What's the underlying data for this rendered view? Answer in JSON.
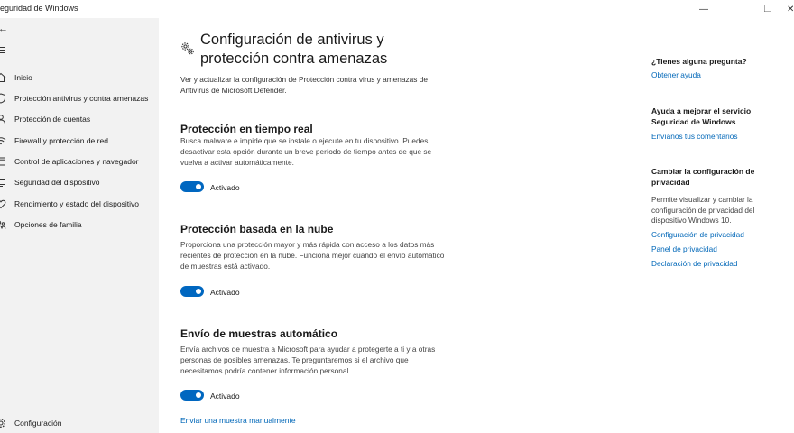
{
  "window": {
    "title": "Seguridad de Windows",
    "minimize_glyph": "—",
    "maximize_glyph": "❐",
    "close_glyph": "✕"
  },
  "sidebar": {
    "back_glyph": "←",
    "items": [
      {
        "label": "Inicio",
        "icon": "home-icon"
      },
      {
        "label": "Protección antivirus y contra amenazas",
        "icon": "shield-icon"
      },
      {
        "label": "Protección de cuentas",
        "icon": "person-icon"
      },
      {
        "label": "Firewall y protección de red",
        "icon": "wifi-icon"
      },
      {
        "label": "Control de aplicaciones y navegador",
        "icon": "browser-icon"
      },
      {
        "label": "Seguridad del dispositivo",
        "icon": "device-icon"
      },
      {
        "label": "Rendimiento y estado del dispositivo",
        "icon": "heart-icon"
      },
      {
        "label": "Opciones de familia",
        "icon": "family-icon"
      }
    ],
    "settings": {
      "label": "Configuración",
      "icon": "gear-icon"
    }
  },
  "main": {
    "title": "Configuración de antivirus y protección contra amenazas",
    "description": "Ver y actualizar la configuración de Protección contra virus y amenazas de Antivirus de Microsoft Defender.",
    "sections": [
      {
        "title": "Protección en tiempo real",
        "description": "Busca malware e impide que se instale o ejecute en tu dispositivo. Puedes desactivar esta opción durante un breve período de tiempo antes de que se vuelva a activar automáticamente.",
        "toggle_on": true,
        "toggle_label": "Activado"
      },
      {
        "title": "Protección basada en la nube",
        "description": "Proporciona una protección mayor y más rápida con acceso a los datos más recientes de protección en la nube. Funciona mejor cuando el envío automático de muestras está activado.",
        "toggle_on": true,
        "toggle_label": "Activado"
      },
      {
        "title": "Envío de muestras automático",
        "description": "Envía archivos de muestra a Microsoft para ayudar a protegerte a ti y a otras personas de posibles amenazas. Te preguntaremos si el archivo que necesitamos podría contener información personal.",
        "toggle_on": true,
        "toggle_label": "Activado"
      }
    ],
    "manual_link": "Enviar una muestra manualmente"
  },
  "side_panel": {
    "question_heading": "¿Tienes alguna pregunta?",
    "help_link": "Obtener ayuda",
    "improve_heading": "Ayuda a mejorar el servicio Seguridad de Windows",
    "feedback_link": "Envíanos tus comentarios",
    "privacy_heading": "Cambiar la configuración de privacidad",
    "privacy_text": "Permite visualizar y cambiar la configuración de privacidad del dispositivo Windows 10.",
    "privacy_links": [
      "Configuración de privacidad",
      "Panel de privacidad",
      "Declaración de privacidad"
    ]
  },
  "colors": {
    "accent": "#0067c0",
    "link": "#0067b8",
    "sidebar_bg": "#f2f2f2"
  }
}
